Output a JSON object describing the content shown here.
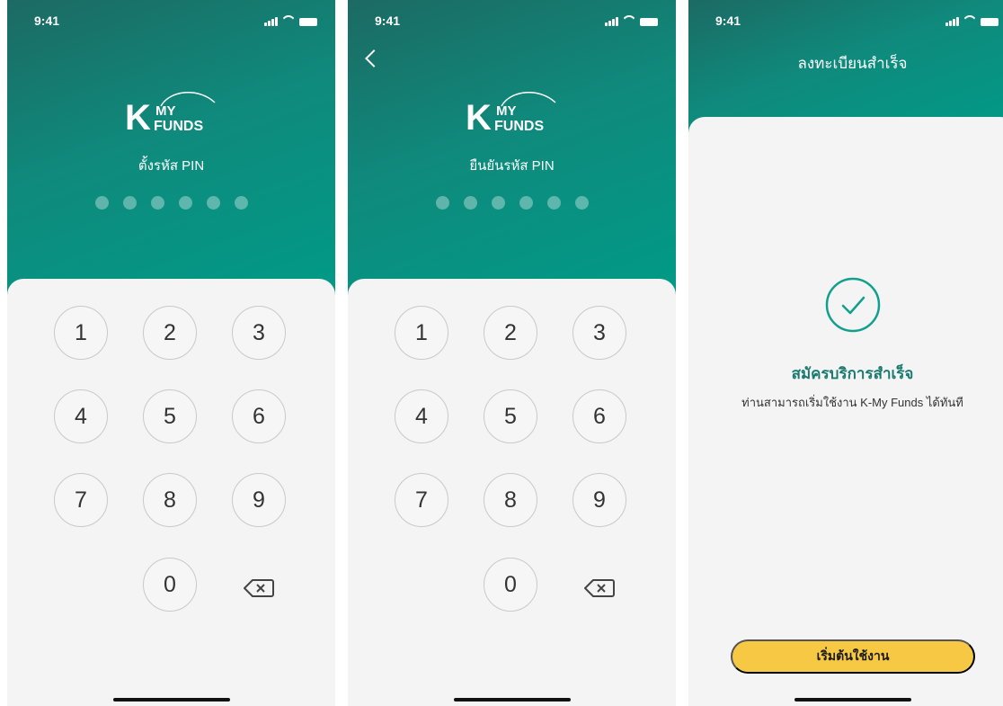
{
  "status_bar": {
    "time": "9:41"
  },
  "logo": {
    "letter": "K",
    "line1": "MY",
    "line2": "FUNDS"
  },
  "screens": [
    {
      "title": "ตั้งรหัส PIN",
      "pin_dots": 6
    },
    {
      "title": "ยืนยันรหัส PIN",
      "pin_dots": 6
    },
    {
      "header_title": "ลงทะเบียนสำเร็จ",
      "success_title": "สมัครบริการสำเร็จ",
      "success_message": "ท่านสามารถเริ่มใช้งาน K-My Funds ได้ทันที",
      "start_button": "เริ่มต้นใช้งาน"
    }
  ],
  "keypad": [
    "1",
    "2",
    "3",
    "4",
    "5",
    "6",
    "7",
    "8",
    "9",
    "0"
  ],
  "icons": {
    "back": "chevron-left-icon",
    "delete": "backspace-icon",
    "success": "check-circle-icon"
  },
  "colors": {
    "brand_green": "#009b88",
    "dark_green": "#1c6a63",
    "button_yellow": "#f7c843",
    "success_text": "#1a7a6f"
  }
}
